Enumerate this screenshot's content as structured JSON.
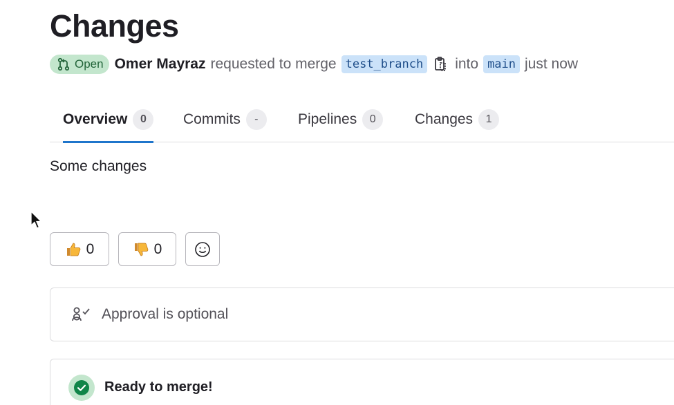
{
  "page": {
    "title": "Changes"
  },
  "meta": {
    "status": "Open",
    "author": "Omer Mayraz",
    "action": "requested to merge",
    "source_branch": "test_branch",
    "into_text": "into",
    "target_branch": "main",
    "time": "just now"
  },
  "tabs": [
    {
      "label": "Overview",
      "count": "0",
      "active": true
    },
    {
      "label": "Commits",
      "count": "-"
    },
    {
      "label": "Pipelines",
      "count": "0"
    },
    {
      "label": "Changes",
      "count": "1"
    }
  ],
  "description": "Some changes",
  "reactions": {
    "thumbs_up_count": "0",
    "thumbs_down_count": "0"
  },
  "approval": {
    "text": "Approval is optional"
  },
  "merge": {
    "title": "Ready to merge!"
  },
  "colors": {
    "accent": "#1f75cb",
    "status_bg": "#c3e6cd",
    "status_fg": "#24663b",
    "branch_bg": "#cbe2f9",
    "branch_fg": "#1f4e8a"
  },
  "icons": {
    "status": "merge-request-icon",
    "copy": "copy-icon",
    "thumbs_up": "thumbs-up-icon",
    "thumbs_down": "thumbs-down-icon",
    "add_emoji": "smiley-icon",
    "approval": "approval-icon",
    "merge_status": "check-circle-icon"
  }
}
